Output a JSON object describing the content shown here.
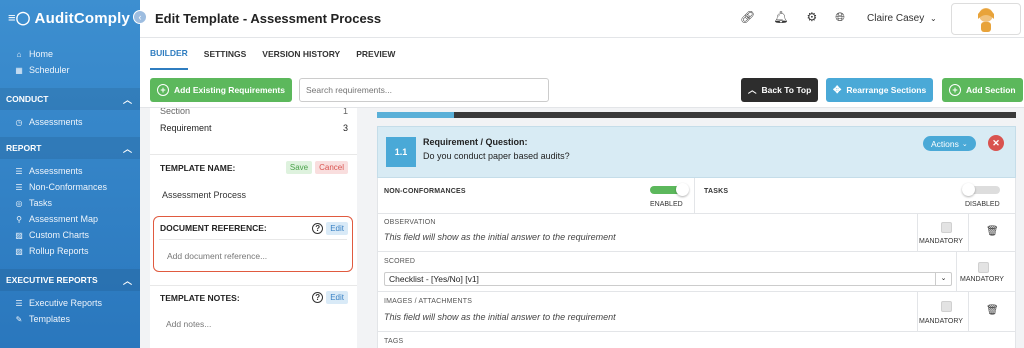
{
  "app": {
    "name": "AuditComply",
    "logo_icon": "≡◯"
  },
  "sidebar": {
    "top_items": [
      {
        "label": "Home",
        "icon": "home-icon"
      },
      {
        "label": "Scheduler",
        "icon": "calendar-icon"
      }
    ],
    "sections": [
      {
        "title": "CONDUCT",
        "items": [
          {
            "label": "Assessments"
          }
        ]
      },
      {
        "title": "REPORT",
        "items": [
          {
            "label": "Assessments"
          },
          {
            "label": "Non-Conformances"
          },
          {
            "label": "Tasks"
          },
          {
            "label": "Assessment Map"
          },
          {
            "label": "Custom Charts"
          },
          {
            "label": "Rollup Reports"
          }
        ]
      },
      {
        "title": "EXECUTIVE REPORTS",
        "items": [
          {
            "label": "Executive Reports"
          },
          {
            "label": "Templates"
          }
        ]
      }
    ]
  },
  "header": {
    "title": "Edit Template - Assessment Process",
    "user_name": "Claire Casey"
  },
  "tabs": [
    "BUILDER",
    "SETTINGS",
    "VERSION HISTORY",
    "PREVIEW"
  ],
  "toolbar": {
    "add_existing": "Add Existing Requirements",
    "search_placeholder": "Search requirements...",
    "back_to_top": "Back To Top",
    "rearrange": "Rearrange Sections",
    "add_section": "Add Section"
  },
  "left": {
    "stats": [
      {
        "label": "Section",
        "value": "1"
      },
      {
        "label": "Requirement",
        "value": "3"
      }
    ],
    "template_name_label": "TEMPLATE NAME:",
    "save": "Save",
    "cancel": "Cancel",
    "template_name_value": "Assessment Process",
    "doc_ref_label": "DOCUMENT REFERENCE:",
    "doc_ref_placeholder": "Add document reference...",
    "notes_label": "TEMPLATE NOTES:",
    "notes_placeholder": "Add notes...",
    "edit": "Edit",
    "help": "?"
  },
  "requirement": {
    "number": "1.1",
    "title": "Requirement / Question:",
    "question": "Do you conduct paper based audits?",
    "actions": "Actions",
    "progress": 0.12,
    "nonconf_label": "NON-CONFORMANCES",
    "nonconf_state": "ENABLED",
    "tasks_label": "TASKS",
    "tasks_state": "DISABLED",
    "observation_label": "OBSERVATION",
    "observation_text": "This field will show as the initial answer to the requirement",
    "scored_label": "SCORED",
    "scored_value": "Checklist - [Yes/No] [v1]",
    "images_label": "IMAGES / ATTACHMENTS",
    "images_text": "This field will show as the initial answer to the requirement",
    "mandatory": "MANDATORY",
    "tags_label": "TAGS",
    "colors": {
      "enabled": "#5cb85c",
      "disabled": "#dddddd"
    }
  }
}
